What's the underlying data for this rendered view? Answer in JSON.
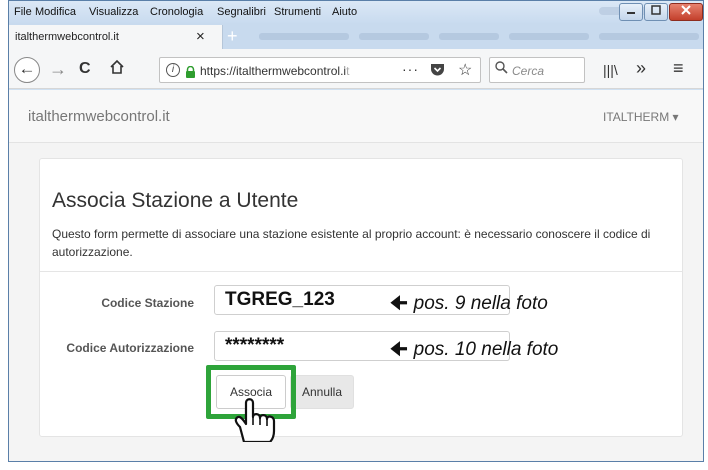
{
  "menubar": {
    "items": [
      {
        "label": "File"
      },
      {
        "label": "Modifica"
      },
      {
        "label": "Visualizza"
      },
      {
        "label": "Cronologia"
      },
      {
        "label": "Segnalibri"
      },
      {
        "label": "Strumenti"
      },
      {
        "label": "Aiuto"
      }
    ]
  },
  "tab": {
    "title": "italthermwebcontrol.it",
    "close": "×",
    "new": "+"
  },
  "navbar": {
    "back": "←",
    "forward": "→",
    "reload": "C",
    "url_main": "https://italthermwebcontrol.i",
    "url_fade": "t",
    "more": "···",
    "star": "☆",
    "search_placeholder": "Cerca",
    "library": "|||\\",
    "overflow": "»",
    "hamburger": "≡"
  },
  "app": {
    "brand": "italthermwebcontrol.it",
    "user_menu": "ITALTHERM ▾"
  },
  "form": {
    "title": "Associa Stazione a Utente",
    "description": "Questo form permette di associare una stazione esistente al proprio account: è necessario conoscere il codice di autorizzazione.",
    "station_label": "Codice Stazione",
    "station_value": "TGREG_123",
    "station_note": "pos. 9 nella foto",
    "auth_label": "Codice Autorizzazione",
    "auth_value": "********",
    "auth_note": "pos. 10 nella foto",
    "submit": "Associa",
    "cancel": "Annulla"
  },
  "colors": {
    "highlight": "#2ea43a"
  }
}
